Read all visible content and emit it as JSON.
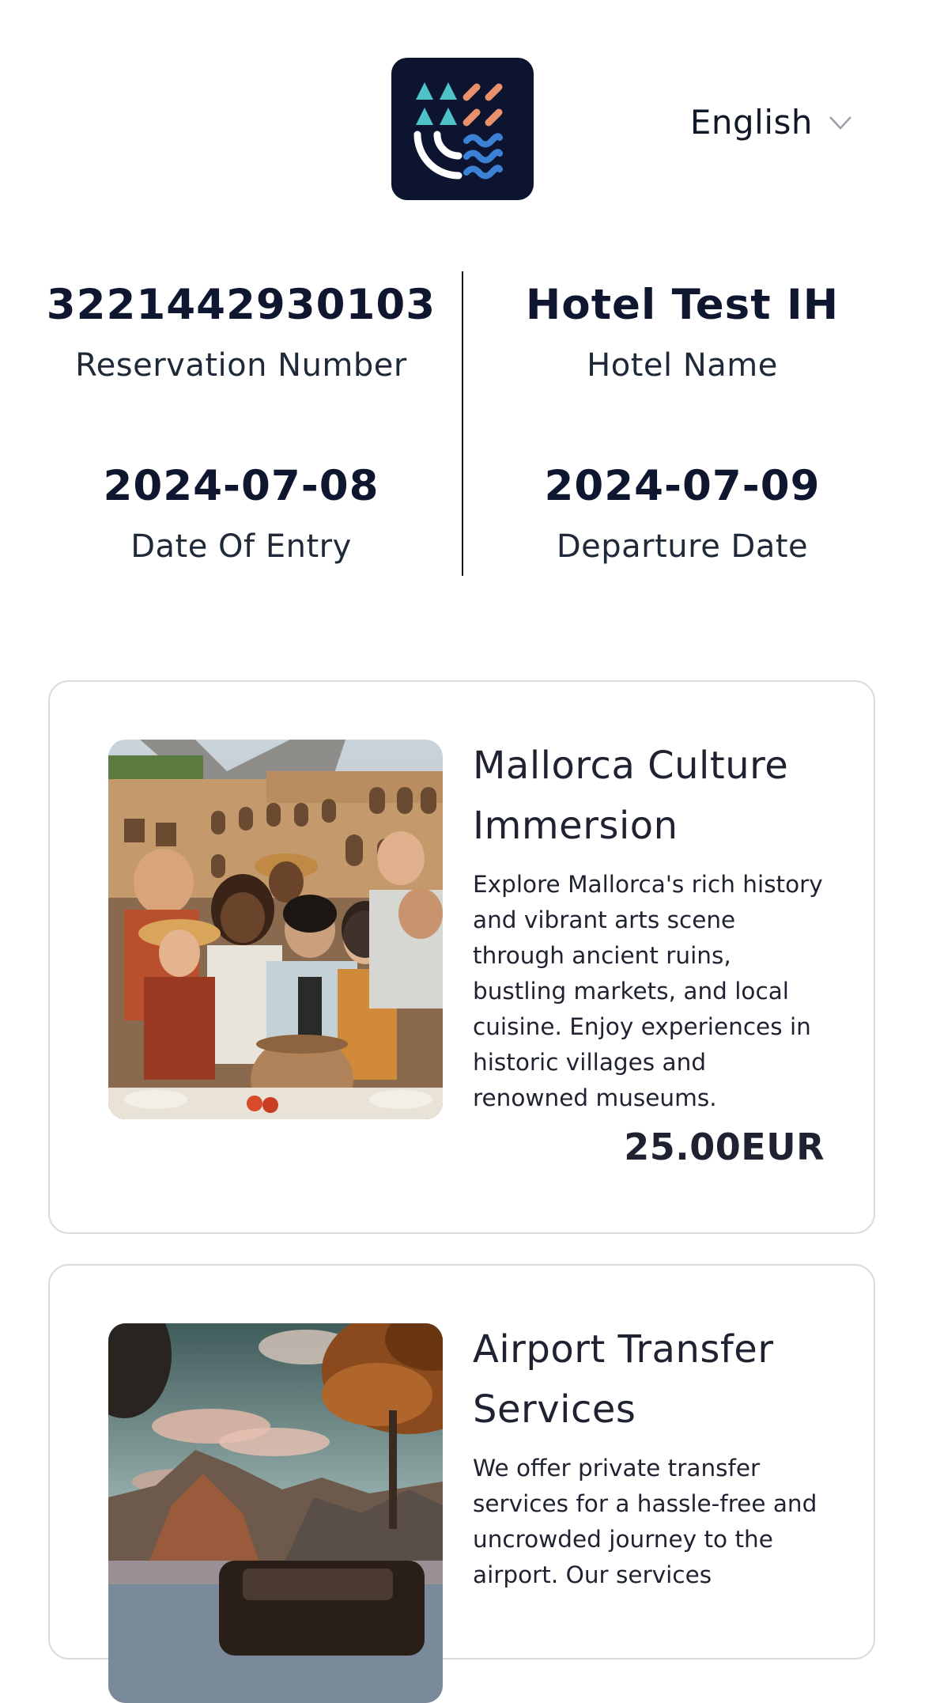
{
  "header": {
    "logo_icon": "brand-logo-icon",
    "language": "English",
    "language_icon": "chevron-down-icon"
  },
  "reservation": {
    "reservation_number": "3221442930103",
    "reservation_number_label": "Reservation Number",
    "hotel_name": "Hotel Test IH",
    "hotel_name_label": "Hotel Name",
    "entry_date": "2024-07-08",
    "entry_date_label": "Date Of Entry",
    "departure_date": "2024-07-09",
    "departure_date_label": "Departure Date"
  },
  "services": [
    {
      "title": "Mallorca Culture Immersion",
      "description": "Explore Mallorca's rich history and vibrant arts scene through ancient ruins, bustling markets, and local cuisine. Enjoy experiences in historic villages and renowned museums.",
      "price": "25.00EUR"
    },
    {
      "title": "Airport Transfer Services",
      "description": "We offer private transfer services for a hassle-free and uncrowded journey to the airport. Our services"
    }
  ],
  "colors": {
    "navy": "#0c1430",
    "logo_teal": "#4cc3c7",
    "logo_orange": "#e8916a",
    "logo_blue": "#3b82d6",
    "border": "#d9d9de"
  }
}
